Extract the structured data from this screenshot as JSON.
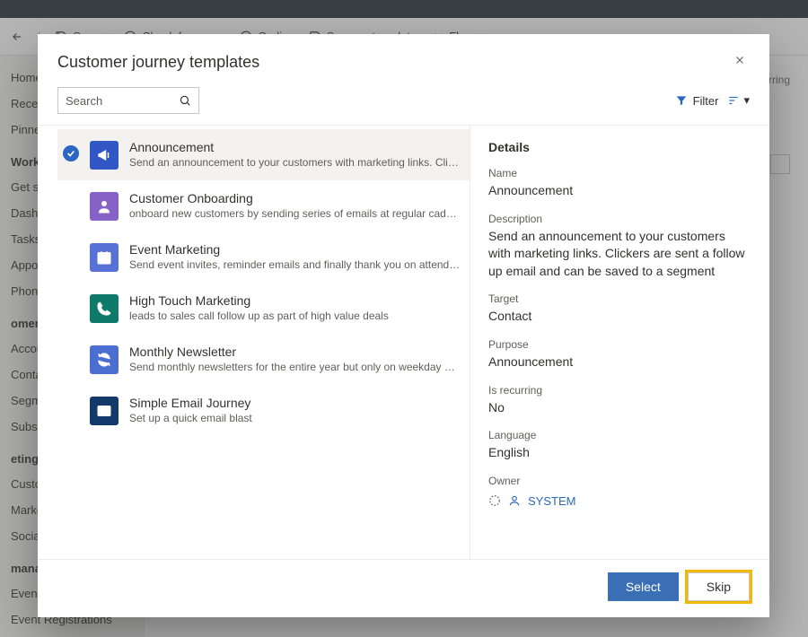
{
  "cmdbar": {
    "back_tooltip": "Back",
    "save": "Save",
    "check": "Check for errors",
    "golive": "Go live",
    "saveas": "Save as template",
    "flow": "Flow"
  },
  "nav": {
    "home": "Home",
    "recent": "Recent",
    "pinned": "Pinned",
    "work_section": "Work",
    "get_started": "Get start",
    "dashboard": "Dashboa",
    "tasks": "Tasks",
    "appoint": "Appoint",
    "phone": "Phone C",
    "customers_section": "omers",
    "accounts": "Account",
    "contacts": "Contacts",
    "segments": "Segmen",
    "subscriptions": "Subscrip",
    "mktexec_section": "eting ex",
    "customer_journeys": "Custome",
    "mkt_emails": "Marketin",
    "social": "Social po",
    "mgmt_section": " manag",
    "events": "Events",
    "event_reg": "Event Registrations"
  },
  "content_area": {
    "recurring_label": "rring"
  },
  "dialog": {
    "title": "Customer journey templates",
    "search_placeholder": "Search",
    "filter_label": "Filter",
    "details_heading": "Details",
    "labels": {
      "name": "Name",
      "description": "Description",
      "target": "Target",
      "purpose": "Purpose",
      "is_recurring": "Is recurring",
      "language": "Language",
      "owner": "Owner"
    },
    "details": {
      "name": "Announcement",
      "description": "Send an announcement to your customers with marketing links. Clickers are sent a follow up email and can be saved to a segment",
      "target": "Contact",
      "purpose": "Announcement",
      "is_recurring": "No",
      "language": "English",
      "owner": "SYSTEM"
    },
    "templates": [
      {
        "title": "Announcement",
        "desc": "Send an announcement to your customers with marketing links. Clickers are sent a…",
        "color": "bg-blue",
        "icon": "megaphone",
        "selected": true
      },
      {
        "title": "Customer Onboarding",
        "desc": "onboard new customers by sending series of emails at regular cadence",
        "color": "bg-purple",
        "icon": "person",
        "selected": false
      },
      {
        "title": "Event Marketing",
        "desc": "Send event invites, reminder emails and finally thank you on attending",
        "color": "bg-blue2",
        "icon": "calendar",
        "selected": false
      },
      {
        "title": "High Touch Marketing",
        "desc": "leads to sales call follow up as part of high value deals",
        "color": "bg-teal",
        "icon": "phone",
        "selected": false
      },
      {
        "title": "Monthly Newsletter",
        "desc": "Send monthly newsletters for the entire year but only on weekday afternoons",
        "color": "bg-blue3",
        "icon": "refresh",
        "selected": false
      },
      {
        "title": "Simple Email Journey",
        "desc": "Set up a quick email blast",
        "color": "bg-navy",
        "icon": "mail",
        "selected": false
      }
    ],
    "buttons": {
      "select": "Select",
      "skip": "Skip"
    }
  }
}
